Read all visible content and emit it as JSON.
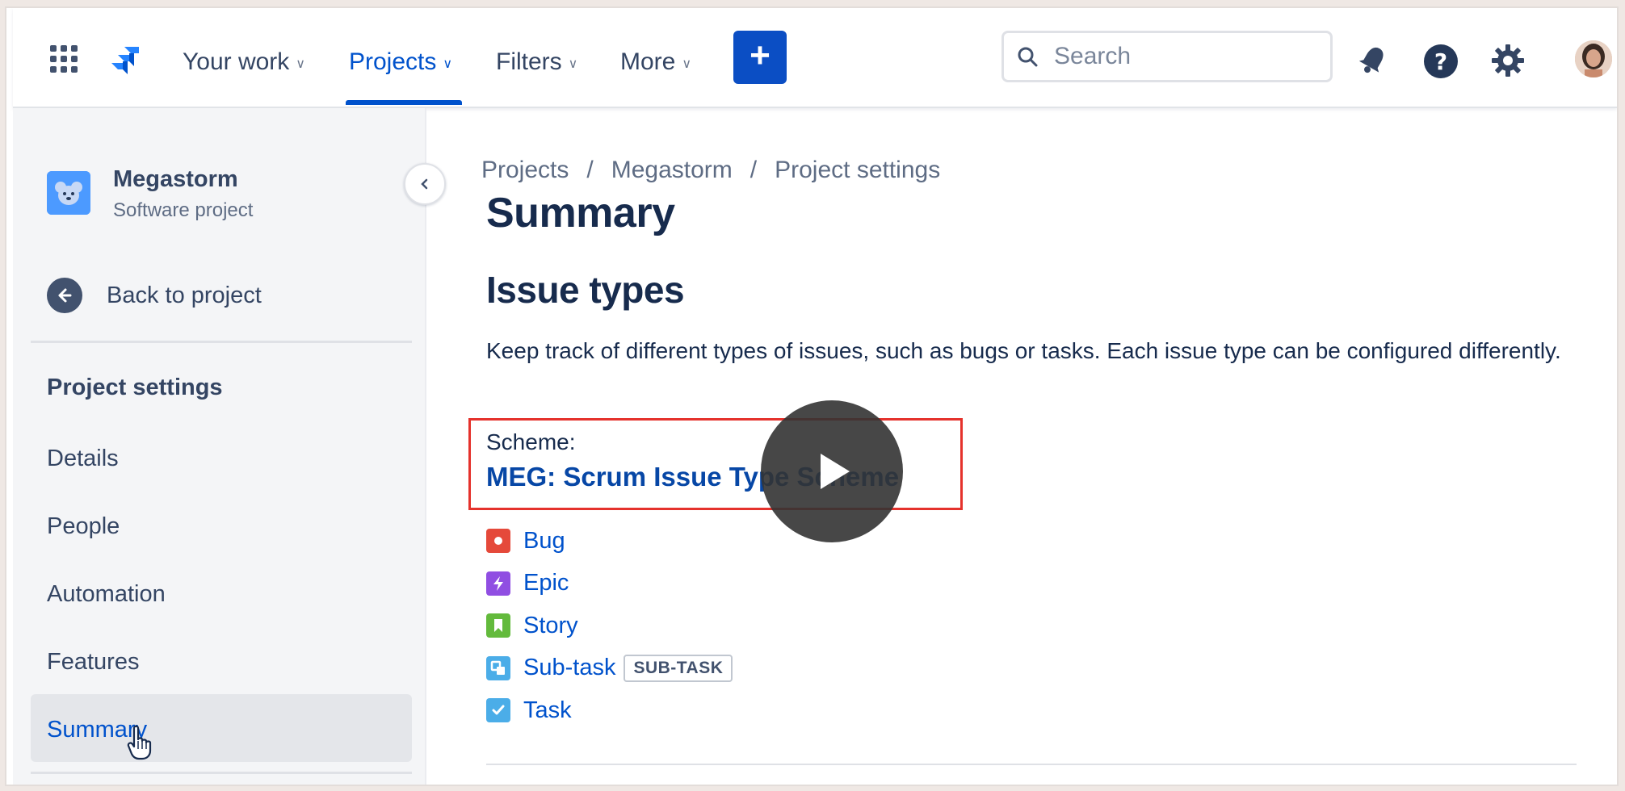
{
  "topnav": {
    "items": [
      {
        "label": "Your work"
      },
      {
        "label": "Projects"
      },
      {
        "label": "Filters"
      },
      {
        "label": "More"
      }
    ],
    "create_label": "+",
    "search_placeholder": "Search",
    "colors": {
      "accent": "#0052cc",
      "create_bg": "#0b4ec4"
    }
  },
  "sidebar": {
    "project_name": "Megastorm",
    "project_type": "Software project",
    "back_label": "Back to project",
    "section_heading": "Project settings",
    "items": [
      {
        "label": "Details"
      },
      {
        "label": "People"
      },
      {
        "label": "Automation"
      },
      {
        "label": "Features"
      },
      {
        "label": "Summary"
      }
    ]
  },
  "main": {
    "breadcrumb": [
      "Projects",
      "Megastorm",
      "Project settings"
    ],
    "breadcrumb_sep": "/",
    "page_title": "Summary",
    "section_title": "Issue types",
    "description": "Keep track of different types of issues, such as bugs or tasks. Each issue type can be configured differently.",
    "scheme_label": "Scheme:",
    "scheme_link": "MEG: Scrum Issue Type Scheme",
    "issue_types": [
      {
        "label": "Bug",
        "icon": "bug-icon",
        "color": "#e5493a"
      },
      {
        "label": "Epic",
        "icon": "epic-icon",
        "color": "#904ee2"
      },
      {
        "label": "Story",
        "icon": "story-icon",
        "color": "#63ba3c"
      },
      {
        "label": "Sub-task",
        "icon": "subtask-icon",
        "color": "#4bade8",
        "lozenge": "SUB-TASK"
      },
      {
        "label": "Task",
        "icon": "task-icon",
        "color": "#4bade8"
      }
    ]
  }
}
